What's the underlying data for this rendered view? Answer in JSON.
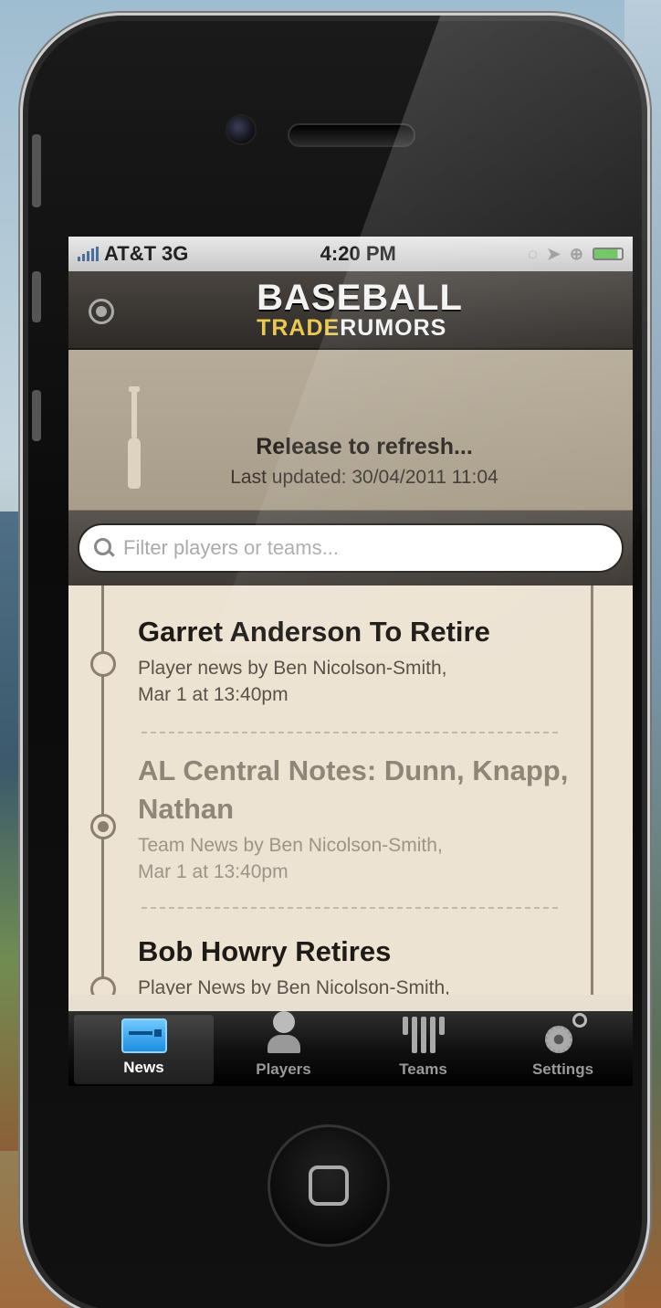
{
  "status_bar": {
    "carrier": "AT&T",
    "network": "3G",
    "time": "4:20 PM"
  },
  "navbar": {
    "logo_top": "BASEBALL",
    "logo_trade": "TRADE",
    "logo_rumors": "RUMORS"
  },
  "refresh": {
    "title": "Release to refresh...",
    "last_updated": "Last updated: 30/04/2011 11:04"
  },
  "search": {
    "placeholder": "Filter players or teams..."
  },
  "news": [
    {
      "title": "Garret Anderson To Retire",
      "meta_line1": "Player news by Ben Nicolson-Smith,",
      "meta_line2": "Mar 1 at 13:40pm",
      "read": false
    },
    {
      "title": "AL Central Notes: Dunn, Knapp, Nathan",
      "meta_line1": "Team News by Ben Nicolson-Smith,",
      "meta_line2": "Mar 1 at 13:40pm",
      "read": true
    },
    {
      "title": "Bob Howry Retires",
      "meta_line1": "Player News by Ben Nicolson-Smith,",
      "meta_line2": "",
      "read": false
    }
  ],
  "tabbar": {
    "tabs": [
      {
        "label": "News",
        "icon": "news-icon",
        "active": true
      },
      {
        "label": "Players",
        "icon": "player-icon",
        "active": false
      },
      {
        "label": "Teams",
        "icon": "jersey-icon",
        "active": false
      },
      {
        "label": "Settings",
        "icon": "gear-icon",
        "active": false
      }
    ]
  },
  "colors": {
    "accent_logo": "#e9c954",
    "tab_active_icon": "#1d8de0"
  }
}
